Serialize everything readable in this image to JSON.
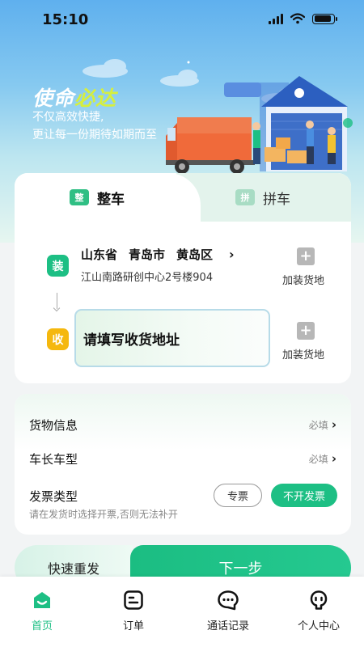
{
  "status_bar": {
    "time": "15:10"
  },
  "hero": {
    "slogan_part1": "使命",
    "slogan_part2": "必达",
    "tagline_line1": "不仅高效快捷,",
    "tagline_line2": "更让每一份期待如期而至"
  },
  "tabs": [
    {
      "label": "整车",
      "icon_text": "整",
      "active": true
    },
    {
      "label": "拼车",
      "icon_text": "拼",
      "active": false
    }
  ],
  "route": {
    "load_badge": "装",
    "origin_province": "山东省",
    "origin_city": "青岛市",
    "origin_district": "黄岛区",
    "origin_detail": "江山南路研创中心2号楼904",
    "recv_badge": "收",
    "dest_placeholder": "请填写收货地址",
    "add_stop_label": "加装货地"
  },
  "info": {
    "goods_label": "货物信息",
    "goods_value": "必填",
    "truck_label": "车长车型",
    "truck_value": "必填",
    "invoice_label": "发票类型",
    "invoice_hint": "请在发货时选择开票,否则无法补开",
    "invoice_special": "专票",
    "invoice_none": "不开发票"
  },
  "actions": {
    "resend": "快速重发",
    "next": "下一步"
  },
  "tabbar": [
    {
      "label": "首页",
      "icon": "home-icon",
      "active": true
    },
    {
      "label": "订单",
      "icon": "orders-icon",
      "active": false
    },
    {
      "label": "通话记录",
      "icon": "chat-bubble-icon",
      "active": false
    },
    {
      "label": "个人中心",
      "icon": "person-icon",
      "active": false
    }
  ],
  "colors": {
    "accent": "#1dbf84",
    "recv": "#f5b80e",
    "slogan_highlight": "#d6ef3d"
  }
}
